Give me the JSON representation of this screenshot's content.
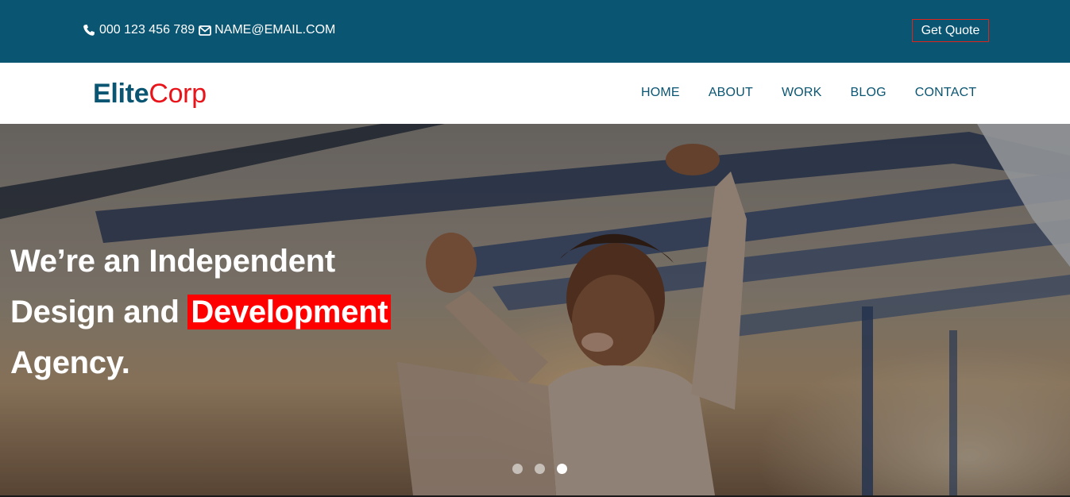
{
  "topbar": {
    "phone": "000 123 456 789",
    "email": "NAME@EMAIL.COM",
    "quote_label": "Get Quote",
    "phone_icon": "phone-icon",
    "email_icon": "envelope-icon",
    "background_color": "#0a5572",
    "quote_border_color": "#e0241c"
  },
  "nav": {
    "logo_part1": "Elite",
    "logo_part2": "Corp",
    "logo_color1": "#0a5572",
    "logo_color2": "#e8141a",
    "links": [
      "HOME",
      "ABOUT",
      "WORK",
      "BLOG",
      "CONTACT"
    ]
  },
  "hero": {
    "line1": "We’re an Independent",
    "line2_pre": "Design and",
    "line2_highlight": "Development",
    "line3": "Agency.",
    "highlight_color": "#ff0000",
    "slide_count": 3,
    "active_slide": 3
  }
}
